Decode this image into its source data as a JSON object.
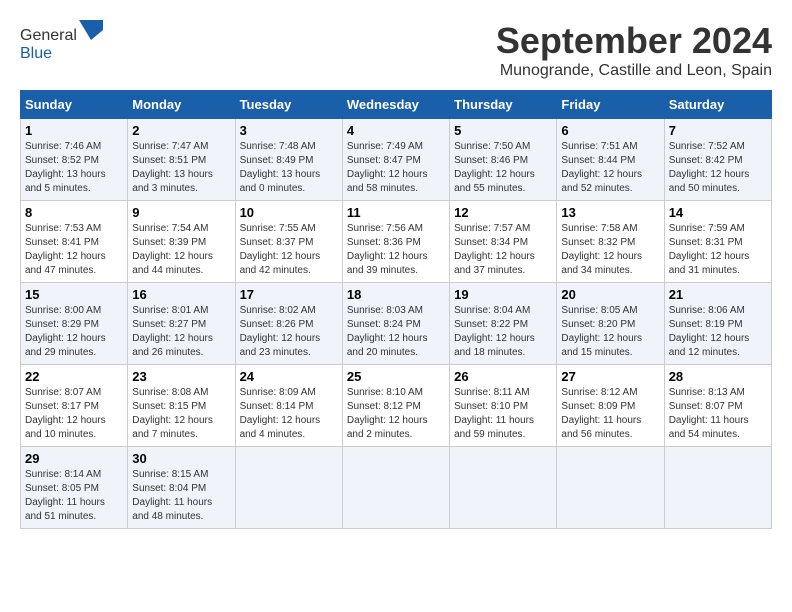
{
  "logo": {
    "general": "General",
    "blue": "Blue"
  },
  "title": "September 2024",
  "location": "Munogrande, Castille and Leon, Spain",
  "days_of_week": [
    "Sunday",
    "Monday",
    "Tuesday",
    "Wednesday",
    "Thursday",
    "Friday",
    "Saturday"
  ],
  "weeks": [
    [
      {
        "day": "1",
        "sunrise": "7:46 AM",
        "sunset": "8:52 PM",
        "daylight": "13 hours and 5 minutes."
      },
      {
        "day": "2",
        "sunrise": "7:47 AM",
        "sunset": "8:51 PM",
        "daylight": "13 hours and 3 minutes."
      },
      {
        "day": "3",
        "sunrise": "7:48 AM",
        "sunset": "8:49 PM",
        "daylight": "13 hours and 0 minutes."
      },
      {
        "day": "4",
        "sunrise": "7:49 AM",
        "sunset": "8:47 PM",
        "daylight": "12 hours and 58 minutes."
      },
      {
        "day": "5",
        "sunrise": "7:50 AM",
        "sunset": "8:46 PM",
        "daylight": "12 hours and 55 minutes."
      },
      {
        "day": "6",
        "sunrise": "7:51 AM",
        "sunset": "8:44 PM",
        "daylight": "12 hours and 52 minutes."
      },
      {
        "day": "7",
        "sunrise": "7:52 AM",
        "sunset": "8:42 PM",
        "daylight": "12 hours and 50 minutes."
      }
    ],
    [
      {
        "day": "8",
        "sunrise": "7:53 AM",
        "sunset": "8:41 PM",
        "daylight": "12 hours and 47 minutes."
      },
      {
        "day": "9",
        "sunrise": "7:54 AM",
        "sunset": "8:39 PM",
        "daylight": "12 hours and 44 minutes."
      },
      {
        "day": "10",
        "sunrise": "7:55 AM",
        "sunset": "8:37 PM",
        "daylight": "12 hours and 42 minutes."
      },
      {
        "day": "11",
        "sunrise": "7:56 AM",
        "sunset": "8:36 PM",
        "daylight": "12 hours and 39 minutes."
      },
      {
        "day": "12",
        "sunrise": "7:57 AM",
        "sunset": "8:34 PM",
        "daylight": "12 hours and 37 minutes."
      },
      {
        "day": "13",
        "sunrise": "7:58 AM",
        "sunset": "8:32 PM",
        "daylight": "12 hours and 34 minutes."
      },
      {
        "day": "14",
        "sunrise": "7:59 AM",
        "sunset": "8:31 PM",
        "daylight": "12 hours and 31 minutes."
      }
    ],
    [
      {
        "day": "15",
        "sunrise": "8:00 AM",
        "sunset": "8:29 PM",
        "daylight": "12 hours and 29 minutes."
      },
      {
        "day": "16",
        "sunrise": "8:01 AM",
        "sunset": "8:27 PM",
        "daylight": "12 hours and 26 minutes."
      },
      {
        "day": "17",
        "sunrise": "8:02 AM",
        "sunset": "8:26 PM",
        "daylight": "12 hours and 23 minutes."
      },
      {
        "day": "18",
        "sunrise": "8:03 AM",
        "sunset": "8:24 PM",
        "daylight": "12 hours and 20 minutes."
      },
      {
        "day": "19",
        "sunrise": "8:04 AM",
        "sunset": "8:22 PM",
        "daylight": "12 hours and 18 minutes."
      },
      {
        "day": "20",
        "sunrise": "8:05 AM",
        "sunset": "8:20 PM",
        "daylight": "12 hours and 15 minutes."
      },
      {
        "day": "21",
        "sunrise": "8:06 AM",
        "sunset": "8:19 PM",
        "daylight": "12 hours and 12 minutes."
      }
    ],
    [
      {
        "day": "22",
        "sunrise": "8:07 AM",
        "sunset": "8:17 PM",
        "daylight": "12 hours and 10 minutes."
      },
      {
        "day": "23",
        "sunrise": "8:08 AM",
        "sunset": "8:15 PM",
        "daylight": "12 hours and 7 minutes."
      },
      {
        "day": "24",
        "sunrise": "8:09 AM",
        "sunset": "8:14 PM",
        "daylight": "12 hours and 4 minutes."
      },
      {
        "day": "25",
        "sunrise": "8:10 AM",
        "sunset": "8:12 PM",
        "daylight": "12 hours and 2 minutes."
      },
      {
        "day": "26",
        "sunrise": "8:11 AM",
        "sunset": "8:10 PM",
        "daylight": "11 hours and 59 minutes."
      },
      {
        "day": "27",
        "sunrise": "8:12 AM",
        "sunset": "8:09 PM",
        "daylight": "11 hours and 56 minutes."
      },
      {
        "day": "28",
        "sunrise": "8:13 AM",
        "sunset": "8:07 PM",
        "daylight": "11 hours and 54 minutes."
      }
    ],
    [
      {
        "day": "29",
        "sunrise": "8:14 AM",
        "sunset": "8:05 PM",
        "daylight": "11 hours and 51 minutes."
      },
      {
        "day": "30",
        "sunrise": "8:15 AM",
        "sunset": "8:04 PM",
        "daylight": "11 hours and 48 minutes."
      },
      null,
      null,
      null,
      null,
      null
    ]
  ],
  "labels": {
    "sunrise": "Sunrise:",
    "sunset": "Sunset:",
    "daylight": "Daylight:"
  }
}
